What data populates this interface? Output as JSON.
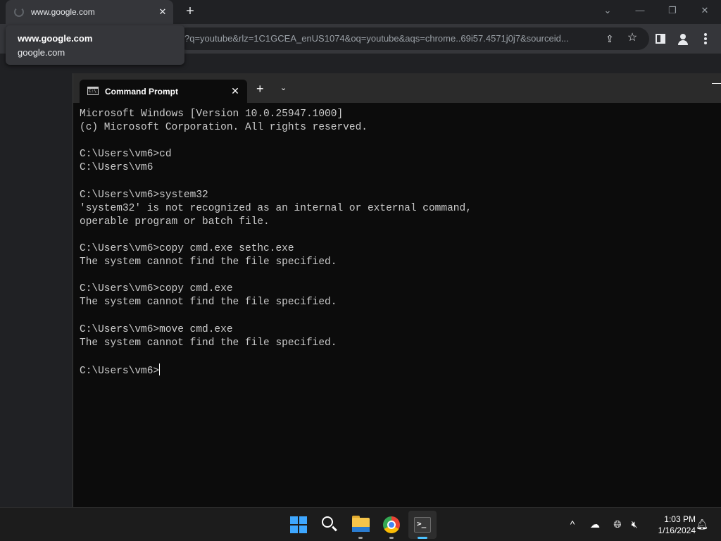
{
  "browser": {
    "tab": {
      "title": "www.google.com",
      "close_label": "✕"
    },
    "new_tab_label": "+",
    "omnibox_url": "?q=youtube&rlz=1C1GCEA_enUS1074&oq=youtube&aqs=chrome..69i57.4571j0j7&sourceid...",
    "tooltip": {
      "title": "www.google.com",
      "url": "google.com"
    },
    "window_controls": {
      "dropdown": "⌄",
      "minimize": "—",
      "restore": "❐",
      "close": "✕"
    }
  },
  "terminal": {
    "tab_title": "Command Prompt",
    "tab_close": "✕",
    "new_tab": "+",
    "dropdown": "⌄",
    "minimize": "—",
    "lines": [
      "Microsoft Windows [Version 10.0.25947.1000]",
      "(c) Microsoft Corporation. All rights reserved.",
      "",
      "C:\\Users\\vm6>cd",
      "C:\\Users\\vm6",
      "",
      "C:\\Users\\vm6>system32",
      "'system32' is not recognized as an internal or external command,",
      "operable program or batch file.",
      "",
      "C:\\Users\\vm6>copy cmd.exe sethc.exe",
      "The system cannot find the file specified.",
      "",
      "C:\\Users\\vm6>copy cmd.exe",
      "The system cannot find the file specified.",
      "",
      "C:\\Users\\vm6>move cmd.exe",
      "The system cannot find the file specified.",
      ""
    ],
    "prompt": "C:\\Users\\vm6>"
  },
  "taskbar": {
    "apps": [
      "start-icon",
      "search-icon",
      "file-explorer-icon",
      "chrome-icon",
      "terminal-icon"
    ],
    "tray": {
      "chevron": "^",
      "time": "1:03 PM",
      "date": "1/16/2024"
    }
  }
}
